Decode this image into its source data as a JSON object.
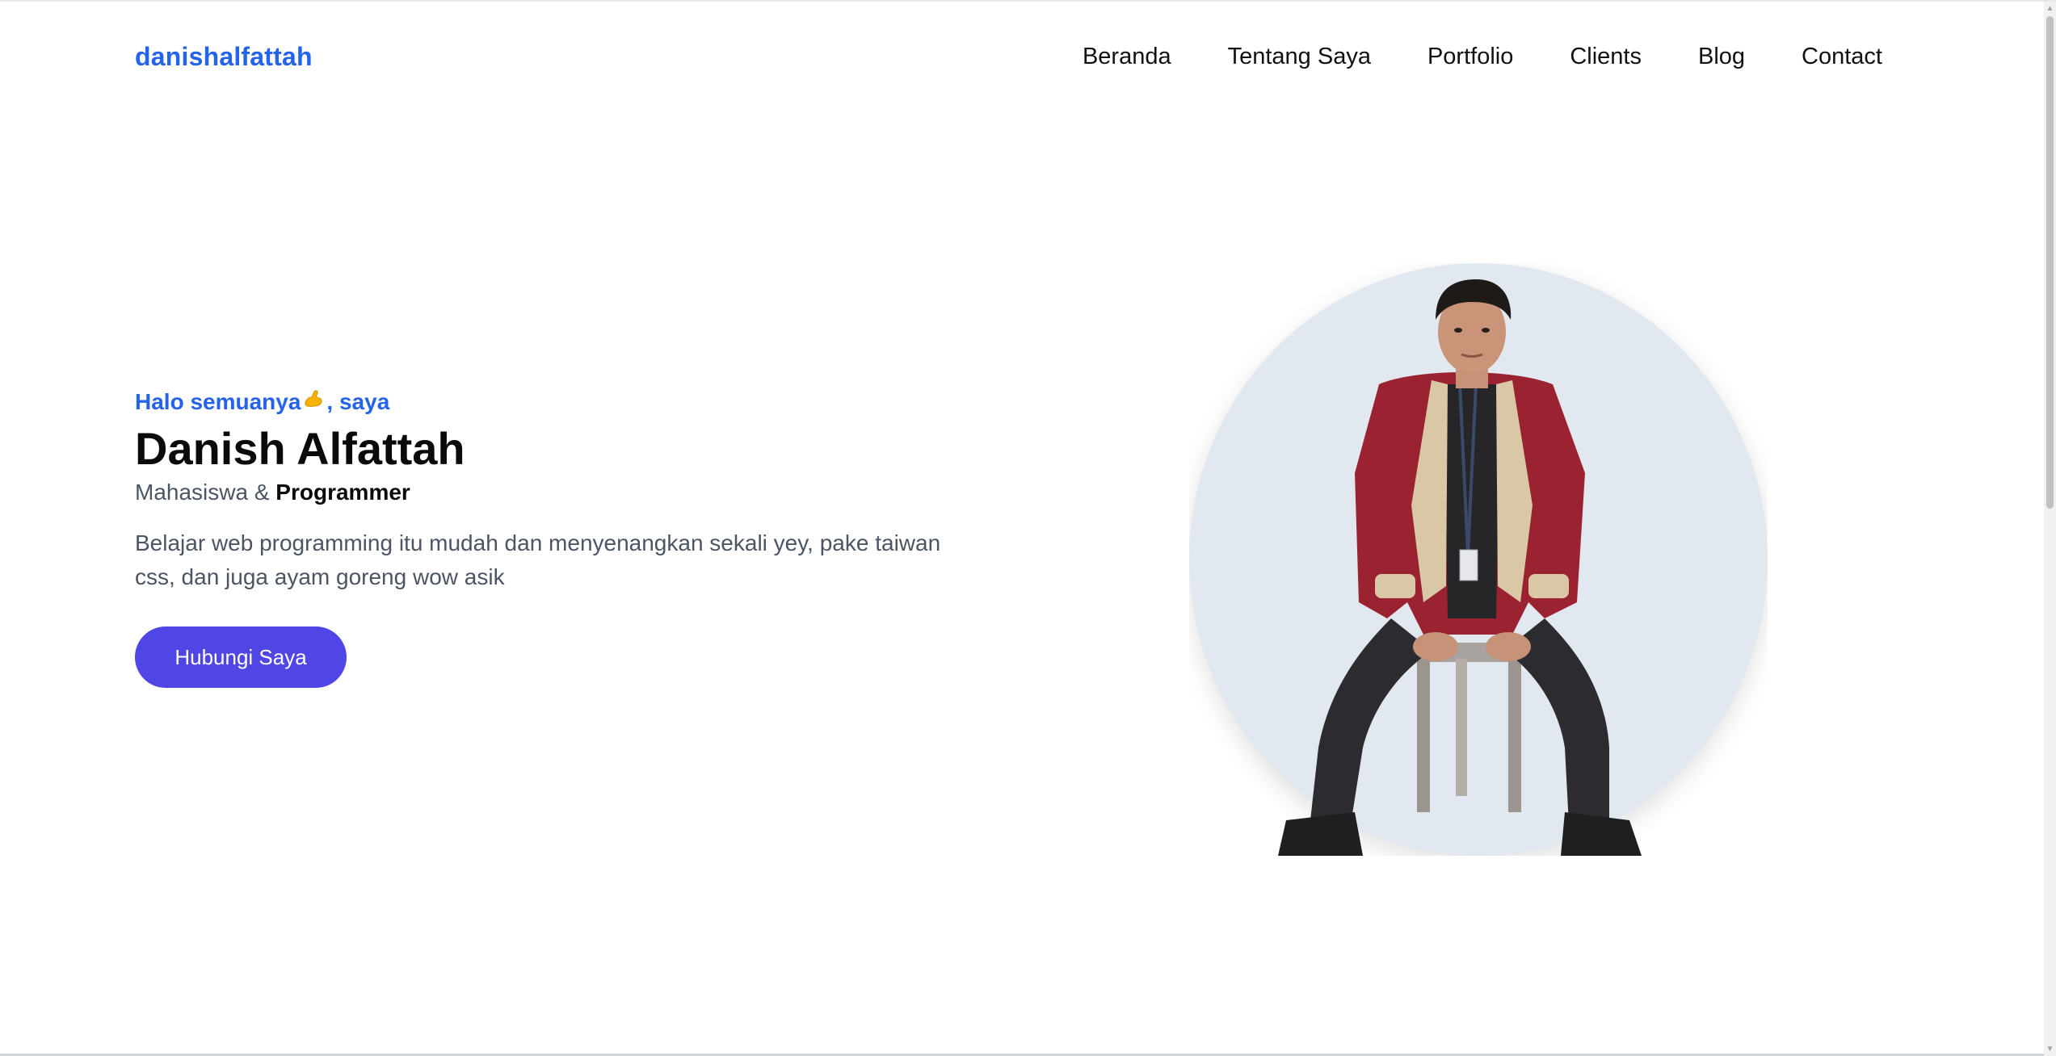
{
  "nav": {
    "brand": "danishalfattah",
    "links": [
      "Beranda",
      "Tentang Saya",
      "Portfolio",
      "Clients",
      "Blog",
      "Contact"
    ]
  },
  "hero": {
    "greeting_before": "Halo semuanya",
    "greeting_emoji": "flexed-biceps-emoji",
    "greeting_after": ", saya",
    "name": "Danish Alfattah",
    "role_prefix": "Mahasiswa & ",
    "role_strong": "Programmer",
    "description": "Belajar web programming itu mudah dan menyenangkan sekali yey, pake taiwan css, dan juga ayam goreng wow asik",
    "cta_label": "Hubungi Saya"
  },
  "colors": {
    "accent": "#2563eb",
    "button": "#4f46e5",
    "circle": "#e2e8f0",
    "text": "#0a0a0a",
    "muted": "#4b5563"
  }
}
